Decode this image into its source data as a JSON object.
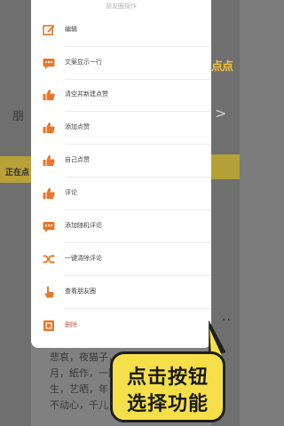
{
  "sheet": {
    "title": "朋友圈操作",
    "items": [
      {
        "icon": "edit-icon",
        "label": "编辑"
      },
      {
        "icon": "comment-icon",
        "label": "文案显示一行"
      },
      {
        "icon": "thumbs-up-icon",
        "label": "清空并新建点赞"
      },
      {
        "icon": "thumbs-up-icon",
        "label": "添加点赞"
      },
      {
        "icon": "thumbs-up-icon",
        "label": "自己点赞"
      },
      {
        "icon": "thumbs-up-icon",
        "label": "评论"
      },
      {
        "icon": "comment-icon",
        "label": "添加随机评论"
      },
      {
        "icon": "shuffle-icon",
        "label": "一键清除评论"
      },
      {
        "icon": "hand-icon",
        "label": "查看朋友圈"
      },
      {
        "icon": "delete-icon",
        "label": "删除",
        "danger": true
      }
    ]
  },
  "background": {
    "header_right": "点点",
    "peng": "朋",
    "yellow_tag": "正在点",
    "lines": [
      "悲哀，夜猫子，大",
      "月，紙作，一陆小",
      "生，艺晒，年日期",
      "不动心，千儿，刊"
    ],
    "more": "··"
  },
  "callout": {
    "line1": "点击按钮",
    "line2": "选择功能"
  },
  "colors": {
    "accent": "#e8762b",
    "callout_bg": "#f6e04a"
  }
}
